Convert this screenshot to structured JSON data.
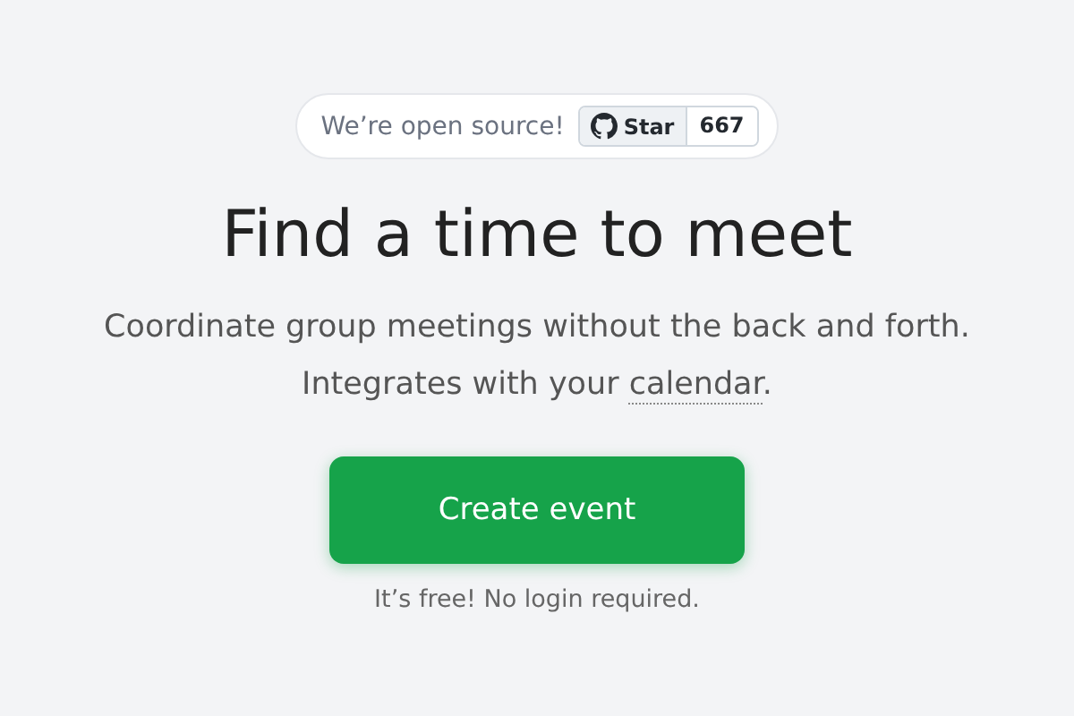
{
  "banner": {
    "text": "We’re open source!",
    "star_button": "Star",
    "star_count": "667"
  },
  "title": "Find a time to meet",
  "subtitle": {
    "line_1": "Coordinate group meetings without the back and forth.",
    "line_2_before": "Integrates with your ",
    "link": "calendar",
    "line_2_after": "."
  },
  "cta_button": "Create event",
  "note": "It’s free! No login required."
}
